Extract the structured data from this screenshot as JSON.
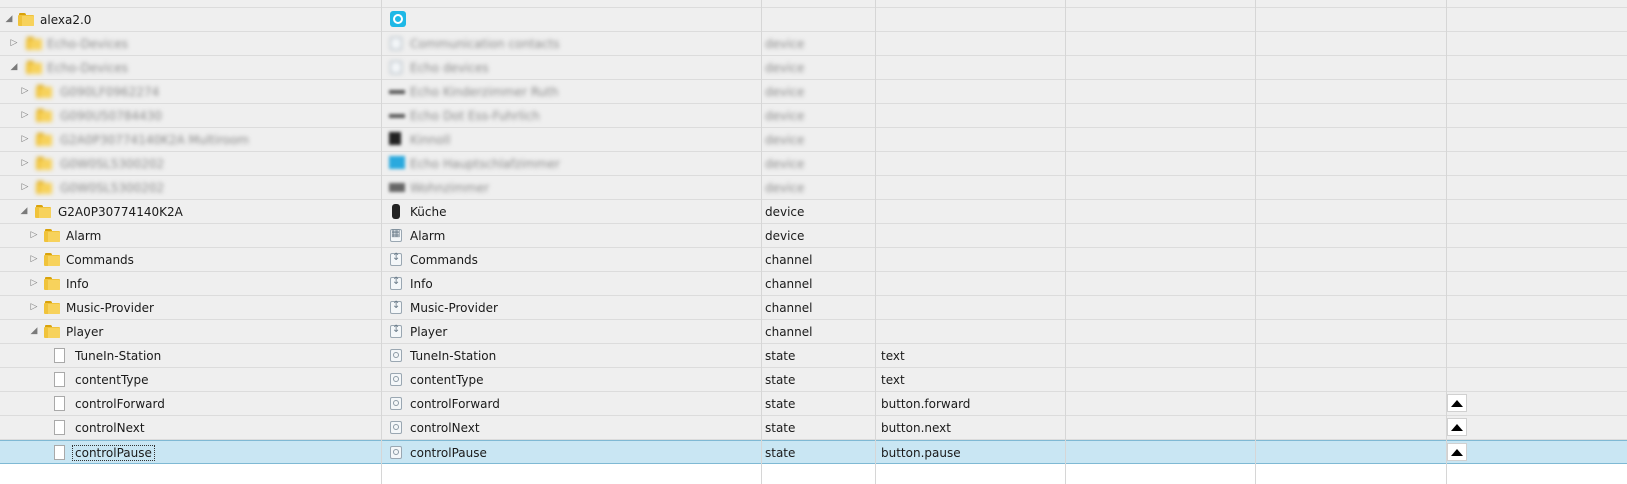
{
  "rows": [
    {
      "name": "alexa2.0",
      "title": "",
      "type": "",
      "role": ""
    },
    {
      "name": "Echo-Devices",
      "title": "Communication contacts",
      "type": "device",
      "role": ""
    },
    {
      "name": "Echo-Devices",
      "title": "Echo devices",
      "type": "device",
      "role": ""
    },
    {
      "name": "G090LF0962274",
      "title": "Echo Kinderzimmer Ruth",
      "type": "device",
      "role": ""
    },
    {
      "name": "G090U50784430",
      "title": "Echo Dot Ess-Fuhrlich",
      "type": "device",
      "role": ""
    },
    {
      "name": "G2A0P30774140K2A Multiroom",
      "title": "Kinnoll",
      "type": "device",
      "role": ""
    },
    {
      "name": "G0W0SL5300202",
      "title": "Echo Hauptschlafzimmer",
      "type": "device",
      "role": ""
    },
    {
      "name": "G0W0SL5300202",
      "title": "Wohnzimmer",
      "type": "device",
      "role": ""
    },
    {
      "name": "G2A0P30774140K2A",
      "title": "Küche",
      "type": "device",
      "role": ""
    },
    {
      "name": "Alarm",
      "title": "Alarm",
      "type": "device",
      "role": ""
    },
    {
      "name": "Commands",
      "title": "Commands",
      "type": "channel",
      "role": ""
    },
    {
      "name": "Info",
      "title": "Info",
      "type": "channel",
      "role": ""
    },
    {
      "name": "Music-Provider",
      "title": "Music-Provider",
      "type": "channel",
      "role": ""
    },
    {
      "name": "Player",
      "title": "Player",
      "type": "channel",
      "role": ""
    },
    {
      "name": "TuneIn-Station",
      "title": "TuneIn-Station",
      "type": "state",
      "role": "text"
    },
    {
      "name": "contentType",
      "title": "contentType",
      "type": "state",
      "role": "text"
    },
    {
      "name": "controlForward",
      "title": "controlForward",
      "type": "state",
      "role": "button.forward"
    },
    {
      "name": "controlNext",
      "title": "controlNext",
      "type": "state",
      "role": "button.next"
    },
    {
      "name": "controlPause",
      "title": "controlPause",
      "type": "state",
      "role": "button.pause"
    }
  ],
  "icons": {
    "expanded": "collapse-triangle-icon",
    "collapsed": "expand-triangle-icon",
    "folder": "folder-icon",
    "file": "file-icon",
    "button": "trigger-button-icon"
  },
  "colors": {
    "selected_row": "#c9e6f3",
    "alexa_icon": "#1eb8e6",
    "folder": "#f0c33b"
  }
}
